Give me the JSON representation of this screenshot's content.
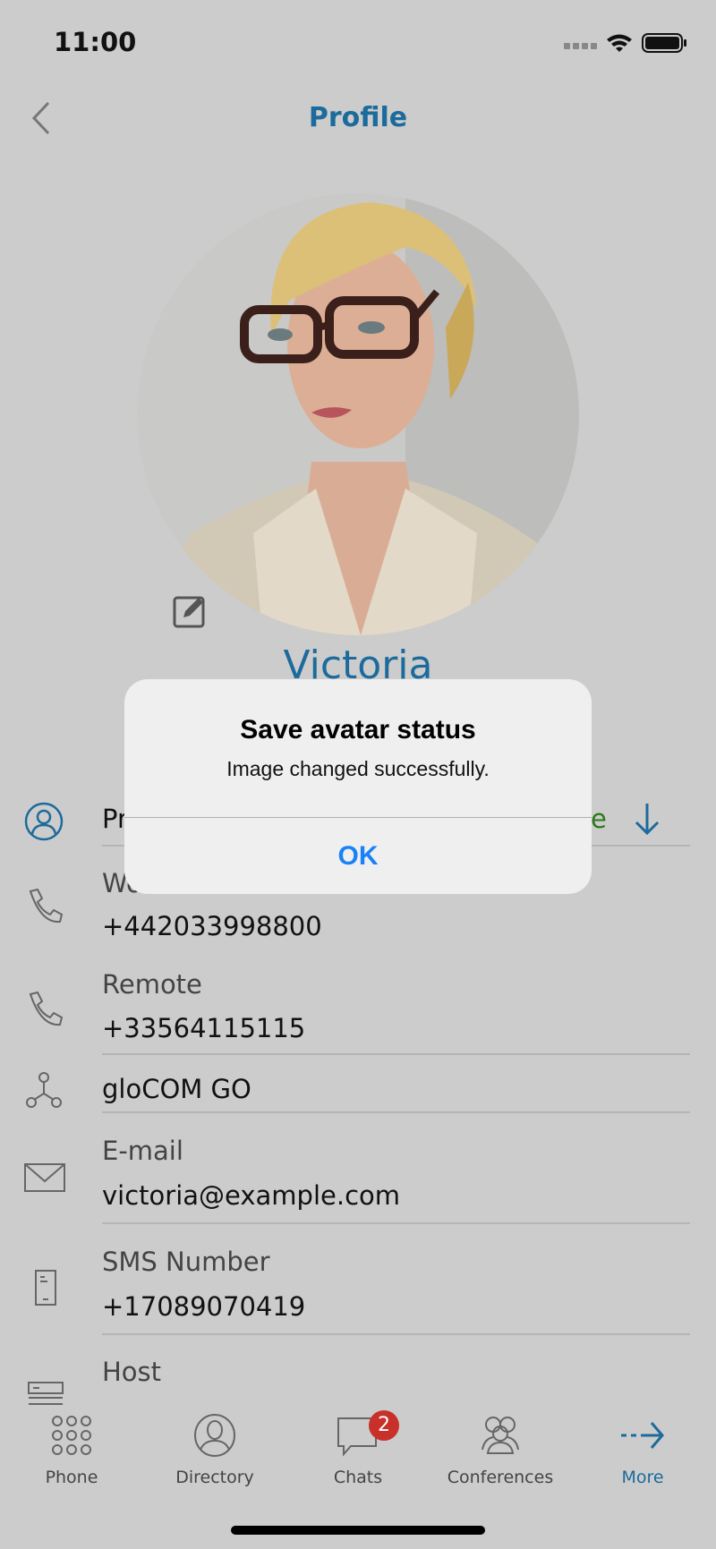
{
  "status_bar": {
    "time": "11:00"
  },
  "header": {
    "title": "Profile"
  },
  "profile": {
    "name": "Victoria",
    "presence_prefix": "Pr",
    "presence_suffix": "e",
    "rows": [
      {
        "label": "Work",
        "value": "+442033998800"
      },
      {
        "label": "Remote",
        "value": "+33564115115"
      },
      {
        "label": "",
        "value": "gloCOM GO"
      },
      {
        "label": "E-mail",
        "value": "victoria@example.com"
      },
      {
        "label": "SMS Number",
        "value": "+17089070419"
      },
      {
        "label": "Host",
        "value": ""
      }
    ],
    "work_label_visible": "W"
  },
  "dialog": {
    "title": "Save avatar status",
    "message": "Image changed successfully.",
    "ok_label": "OK"
  },
  "tabs": [
    {
      "label": "Phone",
      "icon": "keypad-icon"
    },
    {
      "label": "Directory",
      "icon": "person-icon"
    },
    {
      "label": "Chats",
      "icon": "chat-bubble-icon",
      "badge": "2"
    },
    {
      "label": "Conferences",
      "icon": "group-icon"
    },
    {
      "label": "More",
      "icon": "arrow-right-icon",
      "active": true
    }
  ],
  "colors": {
    "accent": "#1c6b9c",
    "ios_blue": "#1a82f7",
    "badge": "#c8302a",
    "presence_green": "#2a7a1a"
  }
}
